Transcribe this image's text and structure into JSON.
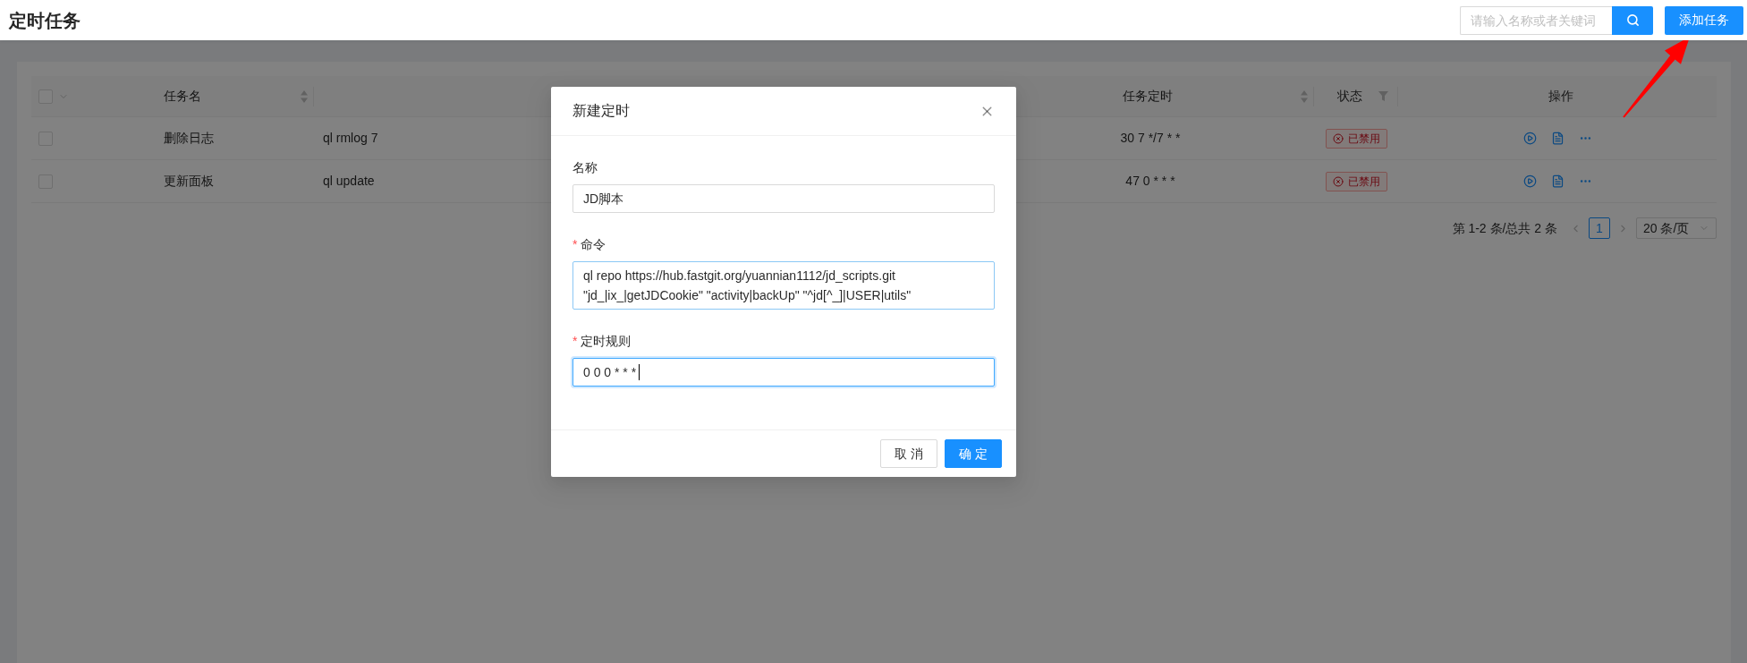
{
  "header": {
    "title": "定时任务",
    "search": {
      "placeholder": "请输入名称或者关键词"
    },
    "add_button": "添加任务"
  },
  "table": {
    "select_all": {
      "checked": false
    },
    "columns": [
      {
        "kind": "sortable",
        "label": "任务名"
      },
      {
        "kind": "blank"
      },
      {
        "kind": "sortable",
        "label": "任务定时"
      },
      {
        "kind": "filter",
        "label": "状态"
      },
      {
        "kind": "plain",
        "label": "操作"
      }
    ],
    "rows": [
      {
        "checked": false,
        "name": "删除日志",
        "command": "ql rmlog 7",
        "schedule": "30 7 */7 * *",
        "status": {
          "kind": "disabled",
          "label": "已禁用"
        }
      },
      {
        "checked": false,
        "name": "更新面板",
        "command": "ql update",
        "schedule": "47 0 * * *",
        "status": {
          "kind": "disabled",
          "label": "已禁用"
        }
      }
    ]
  },
  "pagination": {
    "summary": "第 1-2 条/总共 2 条",
    "pages": [
      {
        "label": "1",
        "selected": true
      }
    ],
    "page_size": "20 条/页"
  },
  "modal": {
    "title": "新建定时",
    "fields": [
      {
        "label": "名称",
        "kind": "input",
        "value": "JD脚本",
        "focused": false,
        "hovered": false
      },
      {
        "required_mark": "*",
        "label": "命令",
        "kind": "textarea",
        "value": "ql repo https://hub.fastgit.org/yuannian1112/jd_scripts.git \"jd_|ix_|getJDCookie\" \"activity|backUp\" \"^jd[^_]|USER|utils\"",
        "focused": false,
        "hovered": true
      },
      {
        "required_mark": "*",
        "label": "定时规则",
        "kind": "input",
        "value": "0 0 0 * * *",
        "focused": true,
        "hovered": false
      }
    ],
    "buttons": [
      {
        "kind": "default",
        "label": "取消"
      },
      {
        "kind": "primary",
        "label": "确定"
      }
    ]
  }
}
